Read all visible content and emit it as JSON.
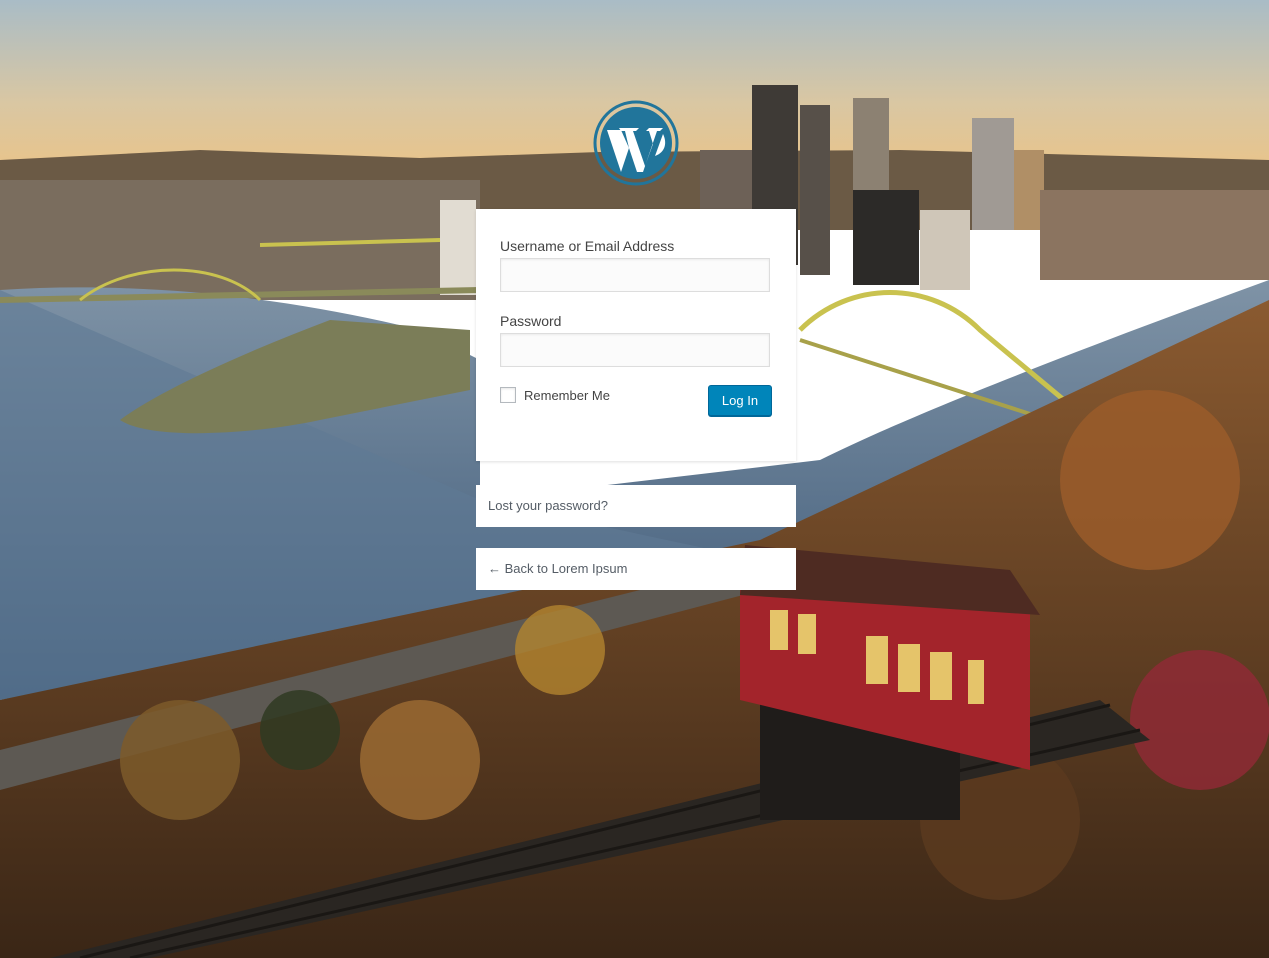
{
  "login_form": {
    "username_label": "Username or Email Address",
    "username_value": "",
    "password_label": "Password",
    "password_value": "",
    "remember_label": "Remember Me",
    "login_button": "Log In"
  },
  "links": {
    "lost_password": "Lost your password?",
    "back_to_site": "← Back to Lorem Ipsum"
  },
  "colors": {
    "primary_button": "#0085ba",
    "logo": "#21759b"
  },
  "icons": {
    "logo": "wordpress-logo-icon"
  }
}
